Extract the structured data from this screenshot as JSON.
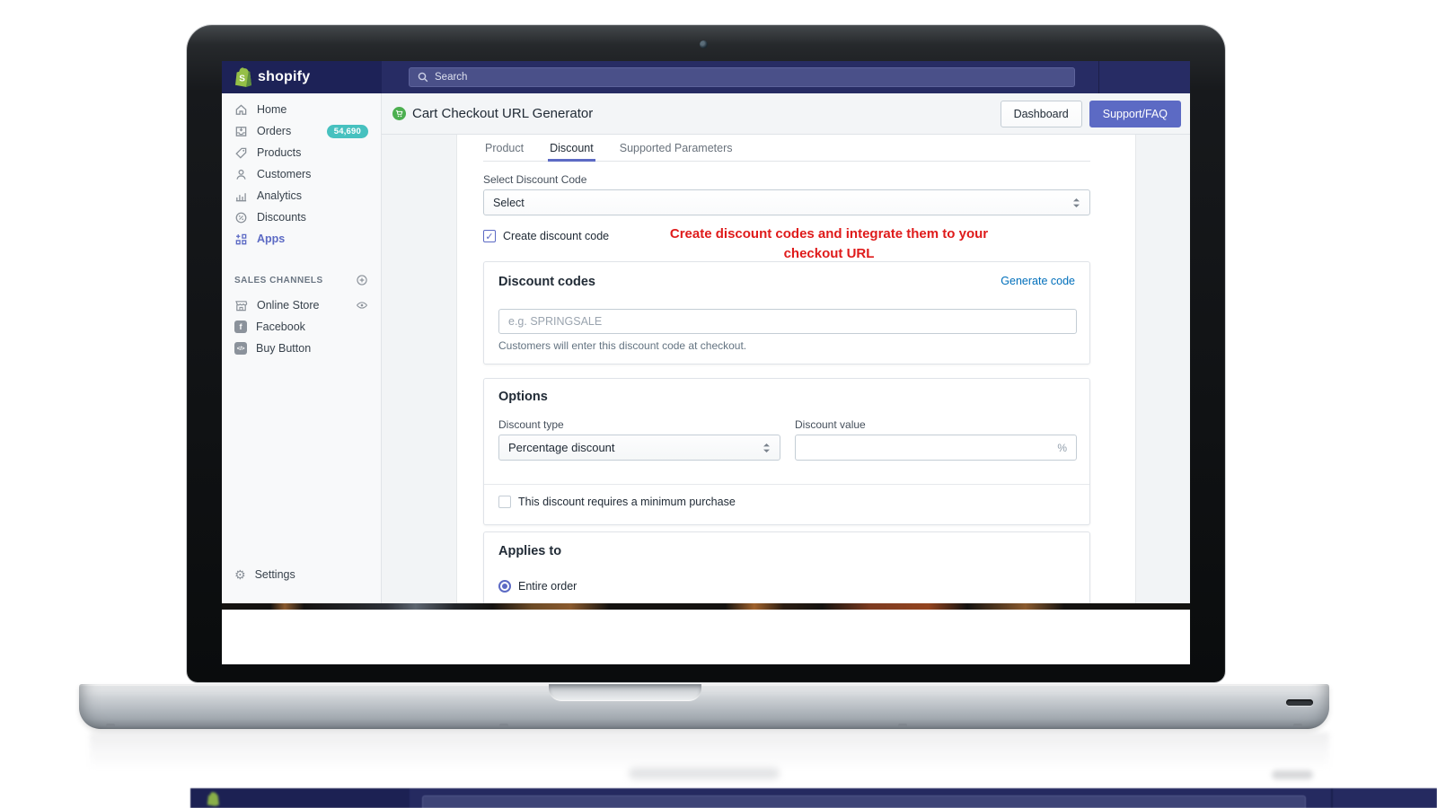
{
  "colors": {
    "accent": "#5c6ac4",
    "badge": "#47c1bf",
    "link": "#006fbb",
    "annotation": "#df1b1b",
    "topbar": "#272c64",
    "logo_green": "#95bf47"
  },
  "topbar": {
    "logo_text": "shopify",
    "search_placeholder": "Search"
  },
  "sidebar": {
    "items": [
      {
        "label": "Home"
      },
      {
        "label": "Orders",
        "badge": "54,690"
      },
      {
        "label": "Products"
      },
      {
        "label": "Customers"
      },
      {
        "label": "Analytics"
      },
      {
        "label": "Discounts"
      },
      {
        "label": "Apps"
      }
    ],
    "sales_channels_label": "SALES CHANNELS",
    "channels": [
      {
        "label": "Online Store"
      },
      {
        "label": "Facebook"
      },
      {
        "label": "Buy Button"
      }
    ],
    "settings_label": "Settings"
  },
  "header": {
    "title": "Cart Checkout URL Generator",
    "dashboard_button": "Dashboard",
    "support_button": "Support/FAQ"
  },
  "tabs": [
    {
      "label": "Product"
    },
    {
      "label": "Discount"
    },
    {
      "label": "Supported Parameters"
    }
  ],
  "form": {
    "select_discount_label": "Select Discount Code",
    "select_value": "Select",
    "create_checkbox_label": "Create discount code",
    "annotation": "Create discount codes and integrate them to your checkout URL",
    "discount_codes": {
      "title": "Discount codes",
      "generate_link": "Generate code",
      "placeholder": "e.g. SPRINGSALE",
      "helper": "Customers will enter this discount code at checkout."
    },
    "options": {
      "title": "Options",
      "discount_type_label": "Discount type",
      "discount_type_value": "Percentage discount",
      "discount_value_label": "Discount value",
      "discount_value_suffix": "%",
      "min_purchase_label": "This discount requires a minimum purchase"
    },
    "applies_to": {
      "title": "Applies to",
      "option": "Entire order"
    }
  },
  "glyphs": {
    "check": "✓",
    "gear": "⚙",
    "facebook": "f",
    "code": "</>"
  }
}
